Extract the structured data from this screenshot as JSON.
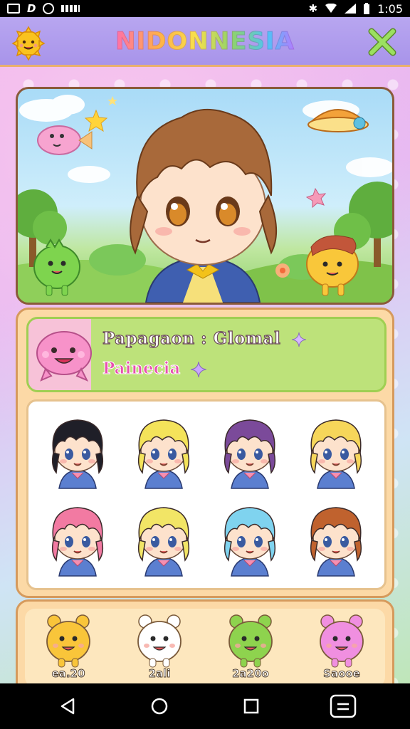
{
  "status_bar": {
    "time": "1:05",
    "icons": [
      "notification-box-icon",
      "d-logo-icon",
      "cat-icon",
      "keyboard-icon",
      "vibrate-icon",
      "wifi-icon",
      "signal-icon",
      "battery-icon"
    ]
  },
  "app": {
    "title": "NIDONNESIA",
    "colors": {
      "header": "#b8a6f0",
      "card": "#fcd9a6",
      "banner": "#bde27a",
      "close": "#8fd16a"
    }
  },
  "profile": {
    "name": "Papagaon : Glomal",
    "subtitle": "Painecia",
    "pet_icon": "pink-blob-icon"
  },
  "characters": [
    {
      "icon": "black-hair-chibi-icon",
      "hair": "#1f1f28"
    },
    {
      "icon": "blonde-chibi-icon",
      "hair": "#f4e35a"
    },
    {
      "icon": "purple-hair-chibi-icon",
      "hair": "#7b4a9a"
    },
    {
      "icon": "blonde-bow-chibi-icon",
      "hair": "#f6d65a"
    },
    {
      "icon": "pink-hair-chibi-icon",
      "hair": "#f27aa2"
    },
    {
      "icon": "yellow-ponytail-chibi-icon",
      "hair": "#f2e566"
    },
    {
      "icon": "blue-hair-chibi-icon",
      "hair": "#7fd3ef"
    },
    {
      "icon": "brown-bun-chibi-icon",
      "hair": "#c0622e"
    }
  ],
  "pets": [
    {
      "label": "ea.20",
      "icon": "yellow-bear-pet-icon",
      "color": "#f9c53a"
    },
    {
      "label": "2ali",
      "icon": "white-cat-pet-icon",
      "color": "#ffffff"
    },
    {
      "label": "2a20o",
      "icon": "green-dino-pet-icon",
      "color": "#8ed34e"
    },
    {
      "label": "Saooe",
      "icon": "pink-blob-pet-icon",
      "color": "#f08fe0"
    }
  ],
  "nav": {
    "back_icon": "back-triangle-icon",
    "home_icon": "home-circle-icon",
    "recents_icon": "recents-square-icon",
    "menu_icon": "menu-icon"
  }
}
